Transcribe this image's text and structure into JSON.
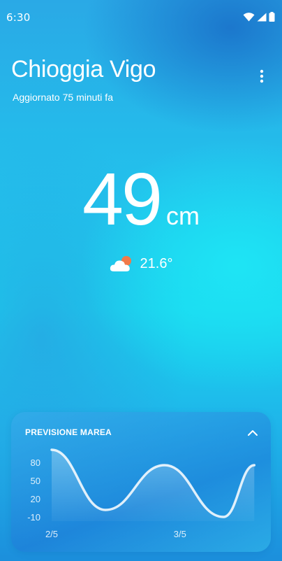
{
  "status_bar": {
    "time": "6:30",
    "icons": [
      "wifi-icon",
      "cellular-signal-icon",
      "battery-icon"
    ]
  },
  "header": {
    "location": "Chioggia Vigo",
    "updated": "Aggiornato 75 minuti fa",
    "menu_icon": "more-vertical-icon"
  },
  "tide": {
    "value": "49",
    "unit": "cm"
  },
  "weather": {
    "icon": "partly-cloudy-icon",
    "temperature": "21.6°"
  },
  "forecast_card": {
    "title": "PREVISIONE MAREA",
    "toggle_icon": "chevron-up-icon"
  },
  "colors": {
    "accent": "#ffffff",
    "sun": "#f07a4a",
    "background_top": "#2aa9e6",
    "background_mid": "#19d6ee"
  },
  "chart_data": {
    "type": "area",
    "title": "PREVISIONE MAREA",
    "xlabel": "",
    "ylabel": "",
    "y_ticks": [
      "80",
      "50",
      "20",
      "-10"
    ],
    "ylim": [
      -10,
      80
    ],
    "x_ticks": [
      {
        "label": "2/5",
        "x": 0
      },
      {
        "label": "3/5",
        "x": 1
      }
    ],
    "xlim": [
      0,
      1.6
    ],
    "grid": false,
    "series": [
      {
        "points": [
          {
            "x": 0.0,
            "y": 86
          },
          {
            "x": 0.42,
            "y": 0
          },
          {
            "x": 0.88,
            "y": 64
          },
          {
            "x": 1.34,
            "y": -10
          },
          {
            "x": 1.58,
            "y": 64
          }
        ]
      }
    ]
  }
}
